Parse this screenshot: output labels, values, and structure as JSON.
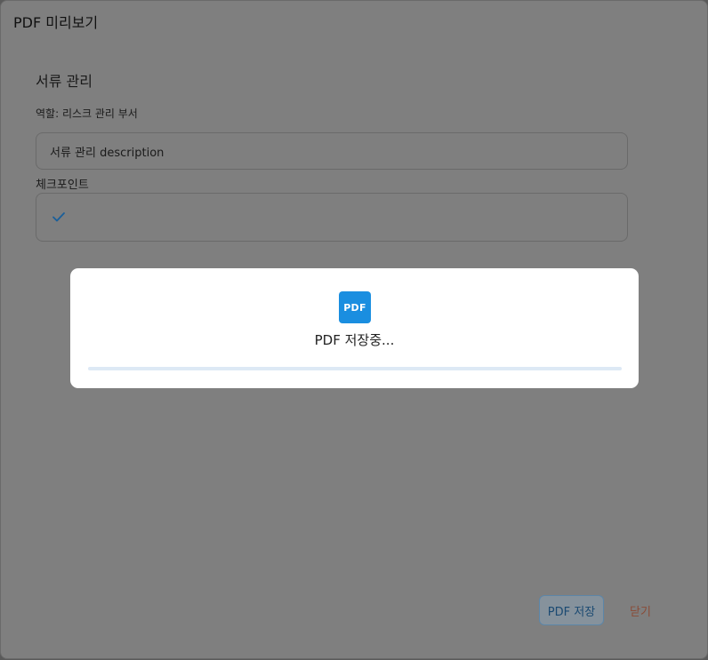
{
  "dialog": {
    "title": "PDF 미리보기"
  },
  "document": {
    "section_title": "서류 관리",
    "role_text": "역할: 리스크 관리 부서",
    "description": "서류 관리 description",
    "checkpoint_label": "체크포인트",
    "checkpoint_icon": "checkmark-icon"
  },
  "saving_modal": {
    "icon_label": "PDF",
    "icon": "pdf-file-icon",
    "message": "PDF 저장중...",
    "progress": 0
  },
  "footer": {
    "save_label": "PDF 저장",
    "close_label": "닫기"
  },
  "colors": {
    "accent": "#1a8ee0",
    "overlay": "#7f7f7f",
    "close_text": "#8a4b36"
  }
}
